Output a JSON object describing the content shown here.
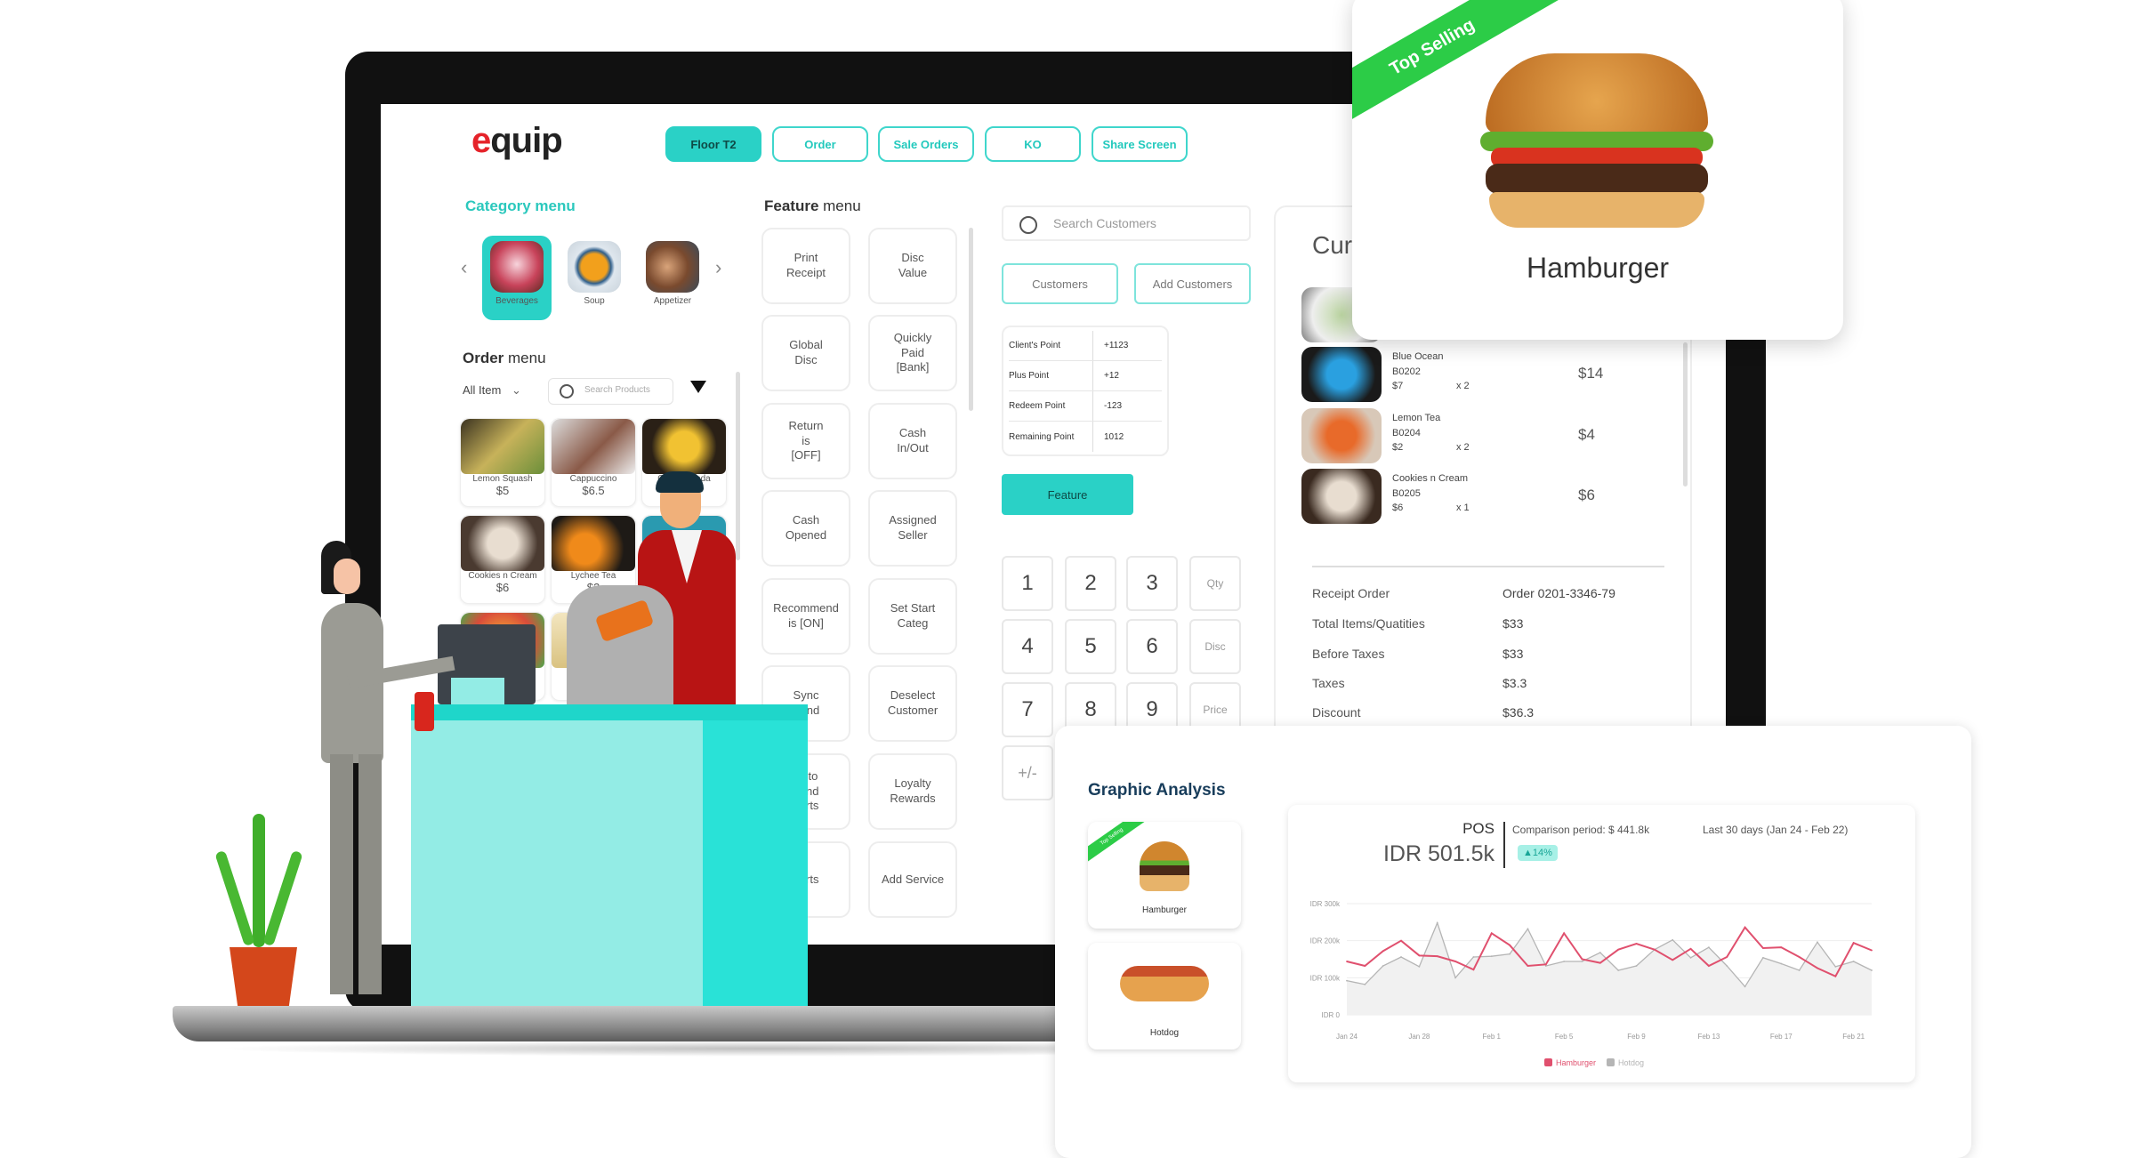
{
  "app": {
    "logo": "equip"
  },
  "nav": {
    "tabs": [
      {
        "label": "Floor T2",
        "active": true
      },
      {
        "label": "Order"
      },
      {
        "label": "Sale Orders"
      },
      {
        "label": "KO"
      },
      {
        "label": "Share Screen"
      }
    ]
  },
  "category_menu": {
    "title": "Category menu",
    "items": [
      {
        "label": "Beverages",
        "active": true
      },
      {
        "label": "Soup"
      },
      {
        "label": "Appetizer"
      }
    ]
  },
  "order_menu": {
    "title_bold": "Order",
    "title_rest": " menu",
    "filter_value": "All Item",
    "search_placeholder": "Search Products",
    "products": [
      {
        "name": "Lemon Squash",
        "price": "$5"
      },
      {
        "name": "Cappuccino",
        "price": "$6.5"
      },
      {
        "name": "Orange Soda",
        "price": ""
      },
      {
        "name": "Cookies n  Cream",
        "price": "$6"
      },
      {
        "name": "Lychee Tea",
        "price": "$2"
      },
      {
        "name": "",
        "price": ""
      }
    ]
  },
  "feature_menu": {
    "title_bold": "Feature",
    "title_rest": " menu",
    "buttons": [
      "Print\nReceipt",
      "Disc\nValue",
      "Global\nDisc",
      "Quickly\nPaid\n[Bank]",
      "Return\nis\n[OFF]",
      "Cash\nIn/Out",
      "Cash\nOpened",
      "Assigned\nSeller",
      "Recommend\nis [ON]",
      "Set Start\nCateg",
      "Sync\nSend",
      "Deselect\nCustomer",
      "Auto\nt and\nports",
      "Loyalty\nRewards",
      "ports",
      "Add Service"
    ]
  },
  "customer": {
    "search_placeholder": "Search Customers",
    "customers_label": "Customers",
    "add_customers_label": "Add Customers",
    "points": [
      {
        "label": "Client's Point",
        "value": "+1123"
      },
      {
        "label": "Plus Point",
        "value": "+12"
      },
      {
        "label": "Redeem Point",
        "value": "-123"
      },
      {
        "label": "Remaining Point",
        "value": "1012"
      }
    ],
    "feature_label": "Feature"
  },
  "keypad": {
    "keys": [
      "1",
      "2",
      "3",
      "Qty",
      "4",
      "5",
      "6",
      "Disc",
      "7",
      "8",
      "9",
      "Price",
      "+/-"
    ]
  },
  "current_order": {
    "title": "Cur",
    "items": [
      {
        "name": "Blue Ocean",
        "code": "B0202",
        "unit": "$7",
        "qty": "x 2",
        "total": "$14"
      },
      {
        "name": "Lemon Tea",
        "code": "B0204",
        "unit": "$2",
        "qty": "x 2",
        "total": "$4"
      },
      {
        "name": "Cookies n Cream",
        "code": "B0205",
        "unit": "$6",
        "qty": "x 1",
        "total": "$6"
      }
    ],
    "summary": [
      {
        "label": "Receipt Order",
        "value": "Order 0201-3346-79"
      },
      {
        "label": "Total Items/Quatities",
        "value": "$33"
      },
      {
        "label": "Before Taxes",
        "value": "$33"
      },
      {
        "label": "Taxes",
        "value": "$3.3"
      },
      {
        "label": "Discount",
        "value": "$36.3"
      }
    ]
  },
  "top_card": {
    "ribbon": "Top Selling",
    "title": "Hamburger"
  },
  "graphic_analysis": {
    "title": "Graphic Analysis",
    "cards": [
      {
        "label": "Hamburger",
        "ribbon": "Top Selling"
      },
      {
        "label": "Hotdog"
      }
    ]
  },
  "chart_data": {
    "type": "line",
    "title": "POS",
    "headline_value": "IDR 501.5k",
    "comparison": "Comparison period: $ 441.8k",
    "change_badge": "▲14%",
    "period": "Last 30 days (Jan 24 - Feb 22)",
    "ylim": [
      0,
      300000
    ],
    "y_ticks": [
      "IDR 0",
      "IDR 100k",
      "IDR 200k",
      "IDR 300k"
    ],
    "x_ticks": [
      "Jan 24",
      "Jan 28",
      "Feb 1",
      "Feb 5",
      "Feb 9",
      "Feb 13",
      "Feb 17",
      "Feb 21"
    ],
    "x": [
      "Jan 24",
      "Jan 25",
      "Jan 26",
      "Jan 27",
      "Jan 28",
      "Jan 29",
      "Jan 30",
      "Jan 31",
      "Feb 1",
      "Feb 2",
      "Feb 3",
      "Feb 4",
      "Feb 5",
      "Feb 6",
      "Feb 7",
      "Feb 8",
      "Feb 9",
      "Feb 10",
      "Feb 11",
      "Feb 12",
      "Feb 13",
      "Feb 14",
      "Feb 15",
      "Feb 16",
      "Feb 17",
      "Feb 18",
      "Feb 19",
      "Feb 20",
      "Feb 21",
      "Feb 22"
    ],
    "series": [
      {
        "name": "Hamburger",
        "color": "#e0506e",
        "values": [
          144000,
          132000,
          172000,
          200000,
          160000,
          158000,
          144000,
          122000,
          220000,
          188000,
          132000,
          136000,
          220000,
          150000,
          140000,
          176000,
          192000,
          176000,
          148000,
          178000,
          132000,
          156000,
          236000,
          180000,
          182000,
          156000,
          126000,
          104000,
          194000,
          174000
        ]
      },
      {
        "name": "Hotdog",
        "color": "#b5b5b5",
        "values": [
          92000,
          82000,
          132000,
          156000,
          130000,
          248000,
          100000,
          156000,
          158000,
          164000,
          232000,
          132000,
          144000,
          144000,
          168000,
          120000,
          132000,
          176000,
          202000,
          154000,
          182000,
          132000,
          76000,
          154000,
          138000,
          120000,
          196000,
          130000,
          144000,
          120000
        ]
      }
    ],
    "legend_position": "bottom",
    "grid": true
  },
  "colors": {
    "accent": "#2ad1c6",
    "ribbon": "#2ccc47",
    "brand_red": "#e5232a",
    "title_navy": "#183d5b"
  }
}
